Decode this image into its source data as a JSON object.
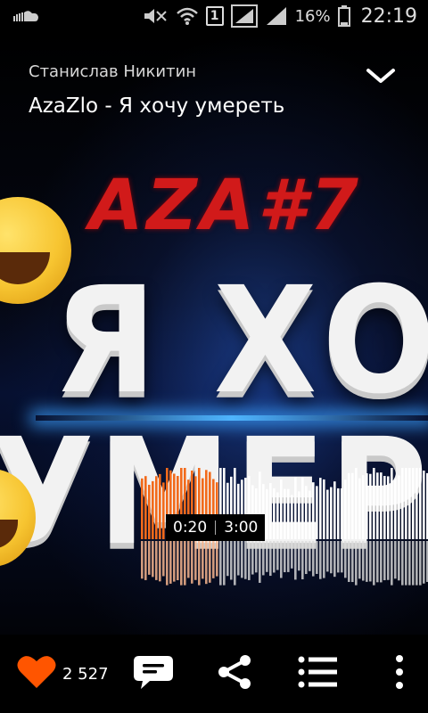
{
  "status_bar": {
    "battery_percent": "16%",
    "time": "22:19",
    "sim_slot": "1",
    "icons": [
      "soundcloud-icon",
      "mute-icon",
      "wifi-icon",
      "sim-icon",
      "signal-icon",
      "signal-icon-2",
      "battery-icon"
    ]
  },
  "header": {
    "artist": "Станислав Никитин",
    "title": "AzaZlo - Я хочу умереть"
  },
  "artwork": {
    "line1": "AZA#7",
    "line2": "Я ХОЧ",
    "line3": "УМЕРЕ"
  },
  "player": {
    "current_time": "0:20",
    "duration": "3:00",
    "progress": 0.111
  },
  "actions": {
    "like_count": "2 527",
    "accent_color": "#ff5500"
  },
  "colors": {
    "accent": "#ff5500",
    "background": "#000000",
    "played_wave": "#f26a1b",
    "unplayed_wave": "#ffffff"
  }
}
